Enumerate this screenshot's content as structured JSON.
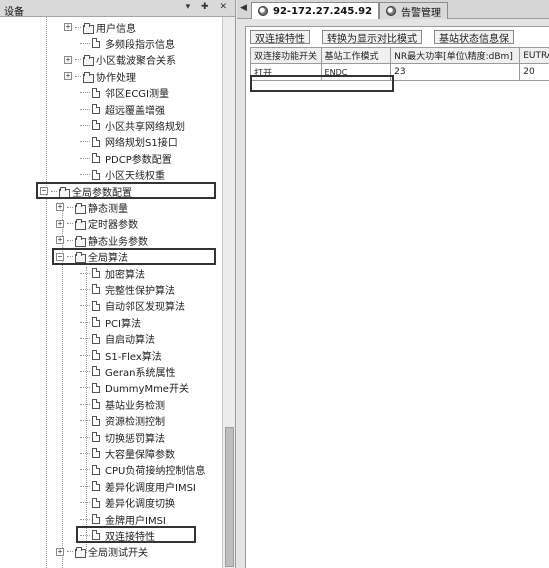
{
  "left_pane": {
    "title": "设备",
    "controls": "▾ ✚ ✕"
  },
  "tree": [
    {
      "label": "用户信息",
      "type": "folder",
      "level": 2
    },
    {
      "label": "多频段指示信息",
      "type": "doc",
      "level": 2
    },
    {
      "label": "小区载波聚合关系",
      "type": "folder",
      "level": 2
    },
    {
      "label": "协作处理",
      "type": "folder",
      "level": 2
    },
    {
      "label": "邻区ECGI测量",
      "type": "doc",
      "level": 2
    },
    {
      "label": "超远覆盖增强",
      "type": "doc",
      "level": 2
    },
    {
      "label": "小区共享网络规划",
      "type": "doc",
      "level": 2
    },
    {
      "label": "网络规划S1接口",
      "type": "doc",
      "level": 2
    },
    {
      "label": "PDCP参数配置",
      "type": "doc",
      "level": 2
    },
    {
      "label": "小区天线权重",
      "type": "doc",
      "level": 2
    },
    {
      "label": "全局参数配置",
      "type": "folder",
      "level": 0,
      "expanded": true,
      "highlight": true
    },
    {
      "label": "静态测量",
      "type": "folder",
      "level": 1
    },
    {
      "label": "定时器参数",
      "type": "folder",
      "level": 1
    },
    {
      "label": "静态业务参数",
      "type": "folder",
      "level": 1
    },
    {
      "label": "全局算法",
      "type": "folder",
      "level": 1,
      "expanded": true,
      "highlight": true
    },
    {
      "label": "加密算法",
      "type": "doc",
      "level": 2
    },
    {
      "label": "完整性保护算法",
      "type": "doc",
      "level": 2
    },
    {
      "label": "自动邻区发现算法",
      "type": "doc",
      "level": 2
    },
    {
      "label": "PCI算法",
      "type": "doc",
      "level": 2
    },
    {
      "label": "自启动算法",
      "type": "doc",
      "level": 2
    },
    {
      "label": "S1-Flex算法",
      "type": "doc",
      "level": 2
    },
    {
      "label": "Geran系统属性",
      "type": "doc",
      "level": 2
    },
    {
      "label": "DummyMme开关",
      "type": "doc",
      "level": 2
    },
    {
      "label": "基站业务检测",
      "type": "doc",
      "level": 2
    },
    {
      "label": "资源检测控制",
      "type": "doc",
      "level": 2
    },
    {
      "label": "切换惩罚算法",
      "type": "doc",
      "level": 2
    },
    {
      "label": "大容量保障参数",
      "type": "doc",
      "level": 2
    },
    {
      "label": "CPU负荷接纳控制信息",
      "type": "doc",
      "level": 2
    },
    {
      "label": "差异化调度用户IMSI",
      "type": "doc",
      "level": 2
    },
    {
      "label": "差异化调度切换",
      "type": "doc",
      "level": 2
    },
    {
      "label": "金牌用户IMSI",
      "type": "doc",
      "level": 2
    },
    {
      "label": "双连接特性",
      "type": "doc",
      "level": 2,
      "highlight": true
    },
    {
      "label": "全局测试开关",
      "type": "folder",
      "level": 1
    }
  ],
  "tabs": [
    {
      "label": "92-172.27.245.92",
      "active": true
    },
    {
      "label": "告警管理",
      "active": false
    }
  ],
  "toolbar": {
    "btn1": "双连接特性",
    "btn2": "转换为显示对比模式",
    "btn3": "基站状态信息保"
  },
  "grid": {
    "headers": [
      "双连接功能开关",
      "基站工作模式",
      "NR最大功率[单位\\精度:dBm]",
      "EUTRA"
    ],
    "rows": [
      [
        "打开",
        "ENDC",
        "23",
        "20"
      ]
    ]
  }
}
